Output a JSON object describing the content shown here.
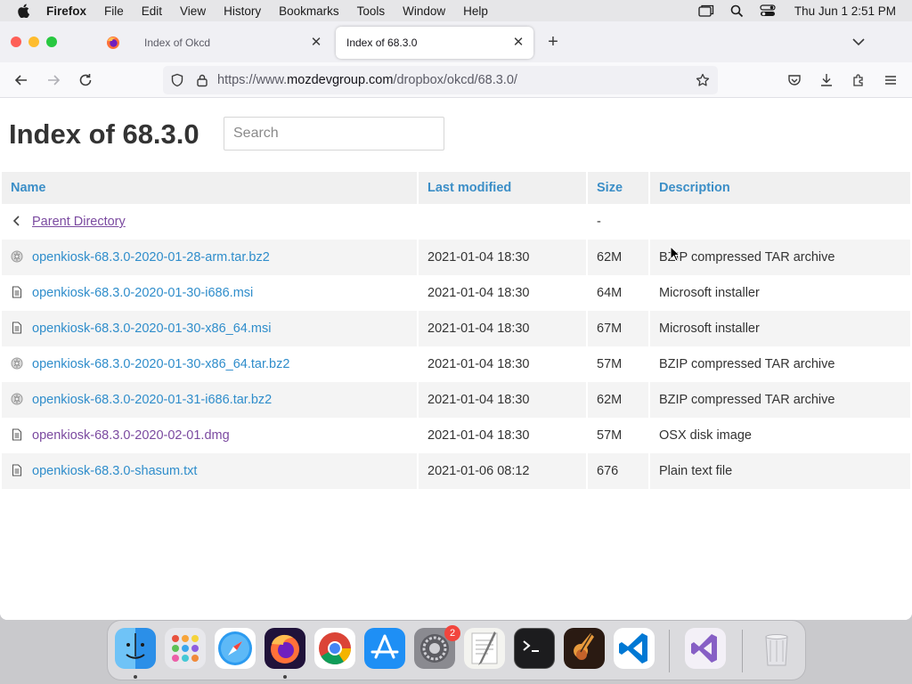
{
  "menubar": {
    "app_name": "Firefox",
    "items": [
      "File",
      "Edit",
      "View",
      "History",
      "Bookmarks",
      "Tools",
      "Window",
      "Help"
    ],
    "clock": "Thu Jun 1  2:51 PM"
  },
  "tabs": [
    {
      "label": "Index of Okcd",
      "active": false
    },
    {
      "label": "Index of 68.3.0",
      "active": true
    }
  ],
  "urlbar": {
    "prefix": "https://www.",
    "domain": "mozdevgroup.com",
    "path": "/dropbox/okcd/68.3.0/"
  },
  "page": {
    "title": "Index of 68.3.0",
    "search_placeholder": "Search"
  },
  "table": {
    "headers": {
      "name": "Name",
      "modified": "Last modified",
      "size": "Size",
      "description": "Description"
    },
    "parent": {
      "label": "Parent Directory",
      "size": "-"
    },
    "rows": [
      {
        "name": "openkiosk-68.3.0-2020-01-28-arm.tar.bz2",
        "modified": "2021-01-04 18:30",
        "size": "62M",
        "description": "BZIP compressed TAR archive",
        "icon": "archive-icon"
      },
      {
        "name": "openkiosk-68.3.0-2020-01-30-i686.msi",
        "modified": "2021-01-04 18:30",
        "size": "64M",
        "description": "Microsoft installer",
        "icon": "document-icon"
      },
      {
        "name": "openkiosk-68.3.0-2020-01-30-x86_64.msi",
        "modified": "2021-01-04 18:30",
        "size": "67M",
        "description": "Microsoft installer",
        "icon": "document-icon"
      },
      {
        "name": "openkiosk-68.3.0-2020-01-30-x86_64.tar.bz2",
        "modified": "2021-01-04 18:30",
        "size": "57M",
        "description": "BZIP compressed TAR archive",
        "icon": "archive-icon"
      },
      {
        "name": "openkiosk-68.3.0-2020-01-31-i686.tar.bz2",
        "modified": "2021-01-04 18:30",
        "size": "62M",
        "description": "BZIP compressed TAR archive",
        "icon": "archive-icon"
      },
      {
        "name": "openkiosk-68.3.0-2020-02-01.dmg",
        "modified": "2021-01-04 18:30",
        "size": "57M",
        "description": "OSX disk image",
        "icon": "document-icon",
        "visited": true
      },
      {
        "name": "openkiosk-68.3.0-shasum.txt",
        "modified": "2021-01-06 08:12",
        "size": "676",
        "description": "Plain text file",
        "icon": "document-icon"
      }
    ]
  },
  "dock": {
    "apps": [
      "Finder",
      "Launchpad",
      "Safari",
      "Firefox",
      "Chrome",
      "App Store",
      "System Settings",
      "TextEdit",
      "Terminal",
      "GarageBand",
      "VS Code",
      "Visual Studio",
      "Trash"
    ],
    "settings_badge": "2"
  },
  "colors": {
    "link": "#2f8dcb",
    "visited": "#7b4aa0",
    "header_text": "#3b8ec7"
  }
}
